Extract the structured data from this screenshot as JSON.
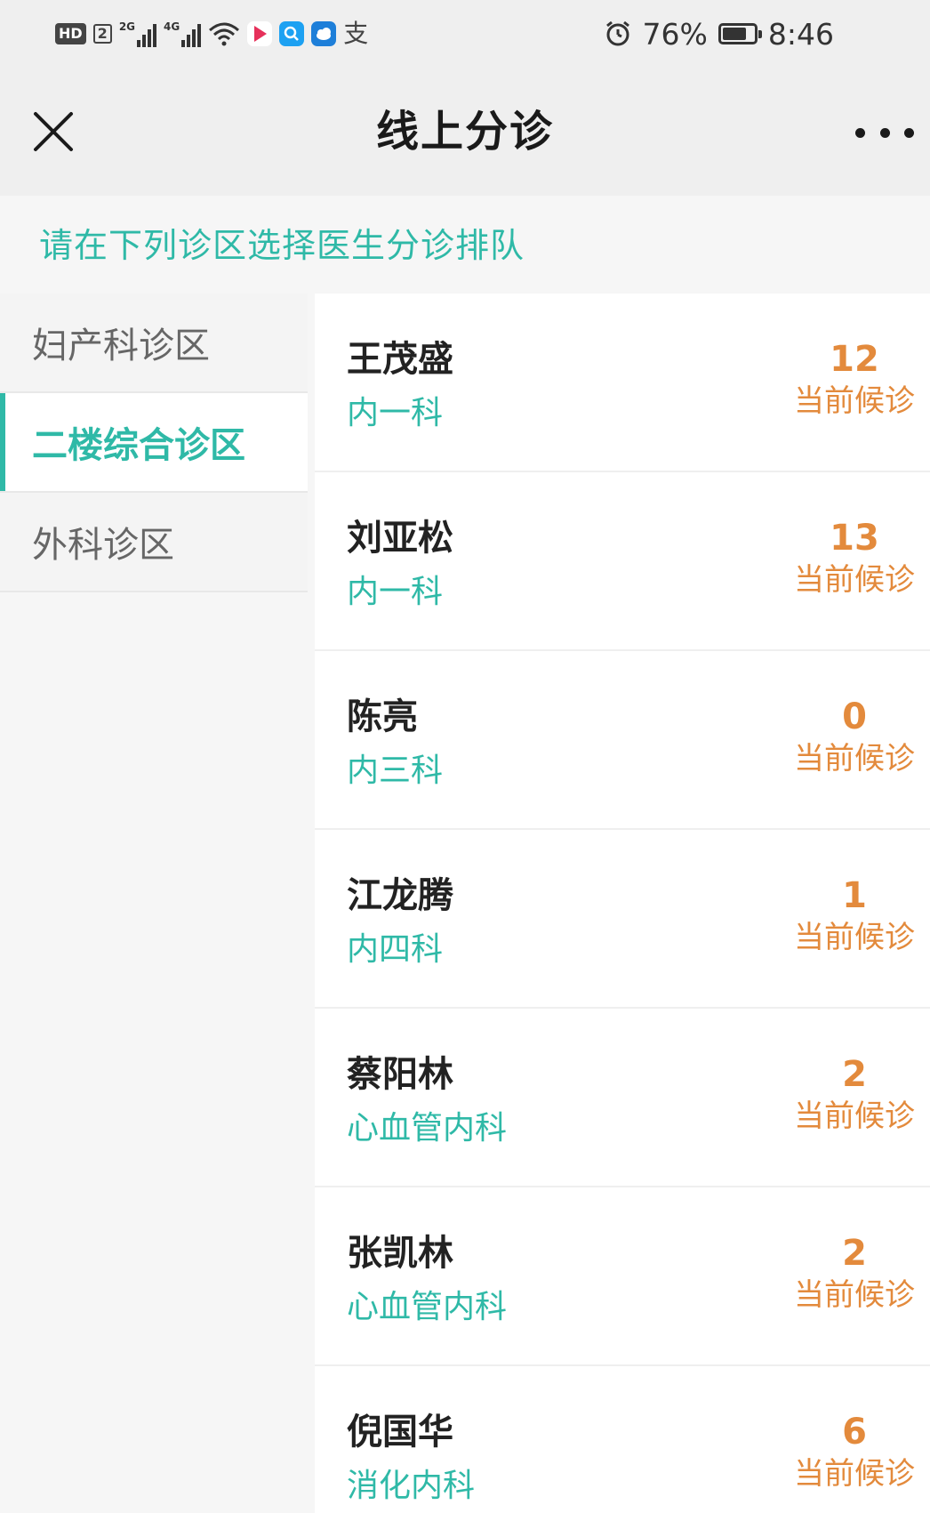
{
  "status_bar": {
    "hd": "HD",
    "sim": "2",
    "net1": "2G",
    "net2": "4G",
    "battery_percent": "76%",
    "battery_level": 0.76,
    "time": "8:46",
    "app_icons": [
      "video-app-icon",
      "search-app-icon",
      "weather-app-icon",
      "alipay-icon"
    ]
  },
  "header": {
    "title": "线上分诊"
  },
  "instruction": "请在下列诊区选择医生分诊排队",
  "sidebar": {
    "items": [
      {
        "label": "妇产科诊区",
        "active": false
      },
      {
        "label": "二楼综合诊区",
        "active": true
      },
      {
        "label": "外科诊区",
        "active": false
      }
    ]
  },
  "doctors": [
    {
      "name": "王茂盛",
      "dept": "内一科",
      "count": "12",
      "label": "当前候诊"
    },
    {
      "name": "刘亚松",
      "dept": "内一科",
      "count": "13",
      "label": "当前候诊"
    },
    {
      "name": "陈亮",
      "dept": "内三科",
      "count": "0",
      "label": "当前候诊"
    },
    {
      "name": "江龙腾",
      "dept": "内四科",
      "count": "1",
      "label": "当前候诊"
    },
    {
      "name": "蔡阳林",
      "dept": "心血管内科",
      "count": "2",
      "label": "当前候诊"
    },
    {
      "name": "张凯林",
      "dept": "心血管内科",
      "count": "2",
      "label": "当前候诊"
    },
    {
      "name": "倪国华",
      "dept": "消化内科",
      "count": "6",
      "label": "当前候诊"
    }
  ],
  "colors": {
    "accent": "#2fb9a7",
    "count": "#e38a3c"
  }
}
